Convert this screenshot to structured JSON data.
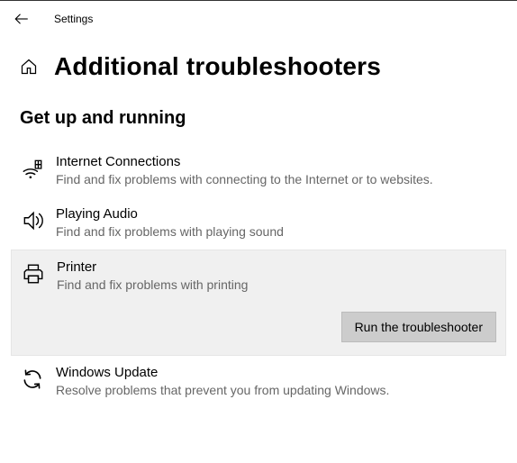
{
  "header": {
    "title": "Settings"
  },
  "page": {
    "title": "Additional troubleshooters"
  },
  "section": {
    "title": "Get up and running"
  },
  "items": [
    {
      "title": "Internet Connections",
      "desc": "Find and fix problems with connecting to the Internet or to websites."
    },
    {
      "title": "Playing Audio",
      "desc": "Find and fix problems with playing sound"
    },
    {
      "title": "Printer",
      "desc": "Find and fix problems with printing"
    },
    {
      "title": "Windows Update",
      "desc": "Resolve problems that prevent you from updating Windows."
    }
  ],
  "run_button": "Run the troubleshooter"
}
